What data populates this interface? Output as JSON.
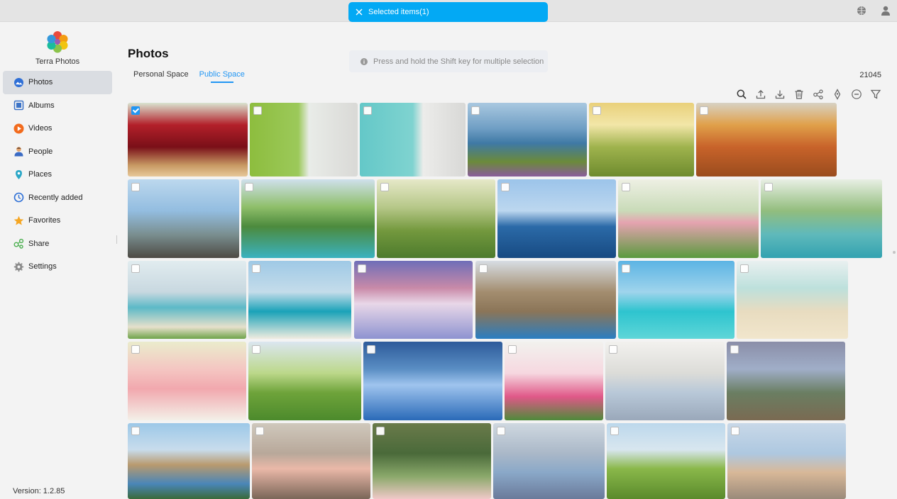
{
  "banner": {
    "label": "Selected items(1)"
  },
  "sidebar": {
    "app_name": "Terra Photos",
    "items": [
      {
        "label": "Photos",
        "icon": "photos-icon",
        "color": "#2f6fd6",
        "active": true
      },
      {
        "label": "Albums",
        "icon": "albums-icon",
        "color": "#3b73c7"
      },
      {
        "label": "Videos",
        "icon": "videos-icon",
        "color": "#f26b1d"
      },
      {
        "label": "People",
        "icon": "people-icon",
        "color": "#3a6bc4"
      },
      {
        "label": "Places",
        "icon": "places-icon",
        "color": "#2aa7c7"
      },
      {
        "label": "Recently added",
        "icon": "recently-added-icon",
        "color": "#2d6fd6"
      },
      {
        "label": "Favorites",
        "icon": "favorites-icon",
        "color": "#f5a623"
      },
      {
        "label": "Share",
        "icon": "share-icon",
        "color": "#4caf50"
      },
      {
        "label": "Settings",
        "icon": "settings-icon",
        "color": "#777777"
      }
    ],
    "version": "Version: 1.2.85"
  },
  "main": {
    "title": "Photos",
    "tabs": [
      {
        "label": "Personal Space",
        "active": false
      },
      {
        "label": "Public Space",
        "active": true
      }
    ],
    "hint": "Press and hold the Shift key for multiple selection",
    "count": "21045"
  },
  "toolbar_icons": [
    "search-icon",
    "upload-icon",
    "download-icon",
    "delete-icon",
    "share-icon",
    "location-icon",
    "more-icon",
    "filter-icon"
  ],
  "colors": {
    "accent": "#03a9f4",
    "tab_active": "#2196f3",
    "checkbox_checked": "#2196f3"
  },
  "photos": [
    {
      "name": "cherries",
      "checked": true
    },
    {
      "name": "white-bench-pink-flowers",
      "checked": false
    },
    {
      "name": "bench-turquoise-wall",
      "checked": false
    },
    {
      "name": "sea-cliff-flowers",
      "checked": false
    },
    {
      "name": "sunset-field-road",
      "checked": false
    },
    {
      "name": "autumn-road-aerial",
      "checked": false
    },
    {
      "name": "hikers-on-mountain",
      "checked": false
    },
    {
      "name": "waterfall-lagoon",
      "checked": false
    },
    {
      "name": "green-hills-path",
      "checked": false
    },
    {
      "name": "ocean-sky",
      "checked": false
    },
    {
      "name": "yoga-couple-garden",
      "checked": false
    },
    {
      "name": "tropical-boat-cliffs",
      "checked": false
    },
    {
      "name": "palm-beach",
      "checked": false
    },
    {
      "name": "island-beach",
      "checked": false
    },
    {
      "name": "snowy-forest-sunset",
      "checked": false
    },
    {
      "name": "otters-and-fish",
      "checked": false
    },
    {
      "name": "turquoise-beach-palms",
      "checked": false
    },
    {
      "name": "hammock-beach",
      "checked": false
    },
    {
      "name": "pink-rose",
      "checked": false
    },
    {
      "name": "meadow-path",
      "checked": false
    },
    {
      "name": "fantasy-water-girl",
      "checked": false
    },
    {
      "name": "roses-frame",
      "checked": false
    },
    {
      "name": "white-bedroom",
      "checked": false
    },
    {
      "name": "fantasy-city-painting",
      "checked": false
    },
    {
      "name": "harbor-fortress",
      "checked": false
    },
    {
      "name": "woman-pink-gown",
      "checked": false
    },
    {
      "name": "tree-tunnel",
      "checked": false
    },
    {
      "name": "anime-angel-girl",
      "checked": false
    },
    {
      "name": "cypress-field",
      "checked": false
    },
    {
      "name": "fairy-castle-painting",
      "checked": false
    }
  ]
}
